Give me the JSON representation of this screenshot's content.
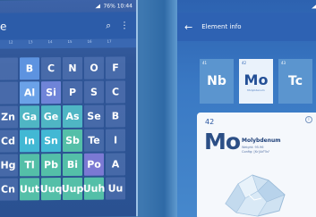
{
  "left": {
    "status_text": "76% 10:44",
    "toolbar": {
      "back": "e",
      "search_icon": "search-icon",
      "menu_icon": "more-icon"
    },
    "column_numbers": [
      "12",
      "13",
      "14",
      "15",
      "16",
      "17"
    ],
    "rows": [
      [
        {
          "sym": "",
          "t": "ghost"
        },
        {
          "sym": "B",
          "t": "blue"
        },
        {
          "sym": "C",
          "t": "ghost"
        },
        {
          "sym": "N",
          "t": "ghost"
        },
        {
          "sym": "O",
          "t": "ghost"
        },
        {
          "sym": "F",
          "t": "ghost"
        },
        {
          "sym": "",
          "t": "empty"
        }
      ],
      [
        {
          "sym": "",
          "t": "ghost"
        },
        {
          "sym": "Al",
          "t": "lblue"
        },
        {
          "sym": "Si",
          "t": "violet"
        },
        {
          "sym": "P",
          "t": "ghost"
        },
        {
          "sym": "S",
          "t": "ghost"
        },
        {
          "sym": "C",
          "t": "ghost"
        },
        {
          "sym": "",
          "t": "empty"
        }
      ],
      [
        {
          "sym": "Zn",
          "t": "ghost"
        },
        {
          "sym": "Ga",
          "t": "teal"
        },
        {
          "sym": "Ge",
          "t": "teal"
        },
        {
          "sym": "As",
          "t": "teal"
        },
        {
          "sym": "Se",
          "t": "ghost"
        },
        {
          "sym": "B",
          "t": "ghost"
        },
        {
          "sym": "",
          "t": "empty"
        }
      ],
      [
        {
          "sym": "Cd",
          "t": "ghost"
        },
        {
          "sym": "In",
          "t": "cyan"
        },
        {
          "sym": "Sn",
          "t": "cyan"
        },
        {
          "sym": "Sb",
          "t": "green"
        },
        {
          "sym": "Te",
          "t": "ghost"
        },
        {
          "sym": "I",
          "t": "ghost"
        },
        {
          "sym": "",
          "t": "empty"
        }
      ],
      [
        {
          "sym": "Hg",
          "t": "ghost"
        },
        {
          "sym": "Tl",
          "t": "green"
        },
        {
          "sym": "Pb",
          "t": "green"
        },
        {
          "sym": "Bi",
          "t": "green"
        },
        {
          "sym": "Po",
          "t": "purple"
        },
        {
          "sym": "A",
          "t": "ghost"
        },
        {
          "sym": "",
          "t": "empty"
        }
      ],
      [
        {
          "sym": "Cn",
          "t": "ghost"
        },
        {
          "sym": "Uut",
          "t": "green"
        },
        {
          "sym": "Uuq",
          "t": "green"
        },
        {
          "sym": "Uup",
          "t": "green"
        },
        {
          "sym": "Uuh",
          "t": "green"
        },
        {
          "sym": "Uu",
          "t": "ghost"
        },
        {
          "sym": "",
          "t": "empty"
        }
      ]
    ]
  },
  "right": {
    "title": "Element info",
    "tiles": [
      {
        "num": "41",
        "sym": "Nb",
        "name": "",
        "active": false
      },
      {
        "num": "42",
        "sym": "Mo",
        "name": "Molybdenum",
        "active": true
      },
      {
        "num": "43",
        "sym": "Tc",
        "name": "",
        "active": false
      }
    ],
    "card": {
      "number": "42",
      "symbol": "Mo",
      "name": "Molybdenum",
      "meta": [
        "Weight: 95.96",
        "Config: [Kr]4d⁵5s¹"
      ]
    }
  }
}
